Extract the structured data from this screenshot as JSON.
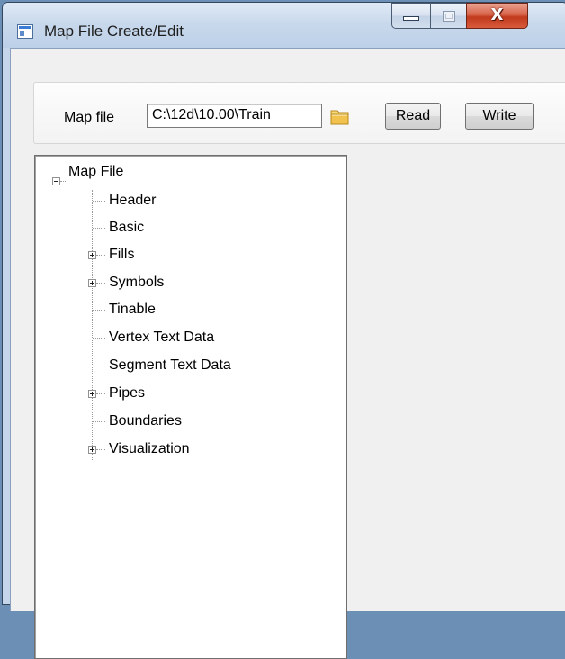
{
  "window": {
    "title": "Map File Create/Edit",
    "close_glyph": "X"
  },
  "toolbar": {
    "map_file_label": "Map file",
    "map_file_value": "C:\\12d\\10.00\\Train",
    "read_label": "Read",
    "write_label": "Write"
  },
  "tree": {
    "root": {
      "label": "Map File",
      "expanded": true
    },
    "items": [
      {
        "label": "Header",
        "expandable": false
      },
      {
        "label": "Basic",
        "expandable": false
      },
      {
        "label": "Fills",
        "expandable": true
      },
      {
        "label": "Symbols",
        "expandable": true
      },
      {
        "label": "Tinable",
        "expandable": false
      },
      {
        "label": "Vertex Text Data",
        "expandable": false
      },
      {
        "label": "Segment Text Data",
        "expandable": false
      },
      {
        "label": "Pipes",
        "expandable": true
      },
      {
        "label": "Boundaries",
        "expandable": false
      },
      {
        "label": "Visualization",
        "expandable": true
      }
    ]
  },
  "icons": {
    "app": "app-window-icon",
    "folder": "folder-icon",
    "minimize": "minimize-icon",
    "maximize": "maximize-icon",
    "close": "close-icon"
  },
  "colors": {
    "close_button": "#c13a1d",
    "folder": "#f2c24e",
    "titlebar": "#c9d9ec"
  }
}
